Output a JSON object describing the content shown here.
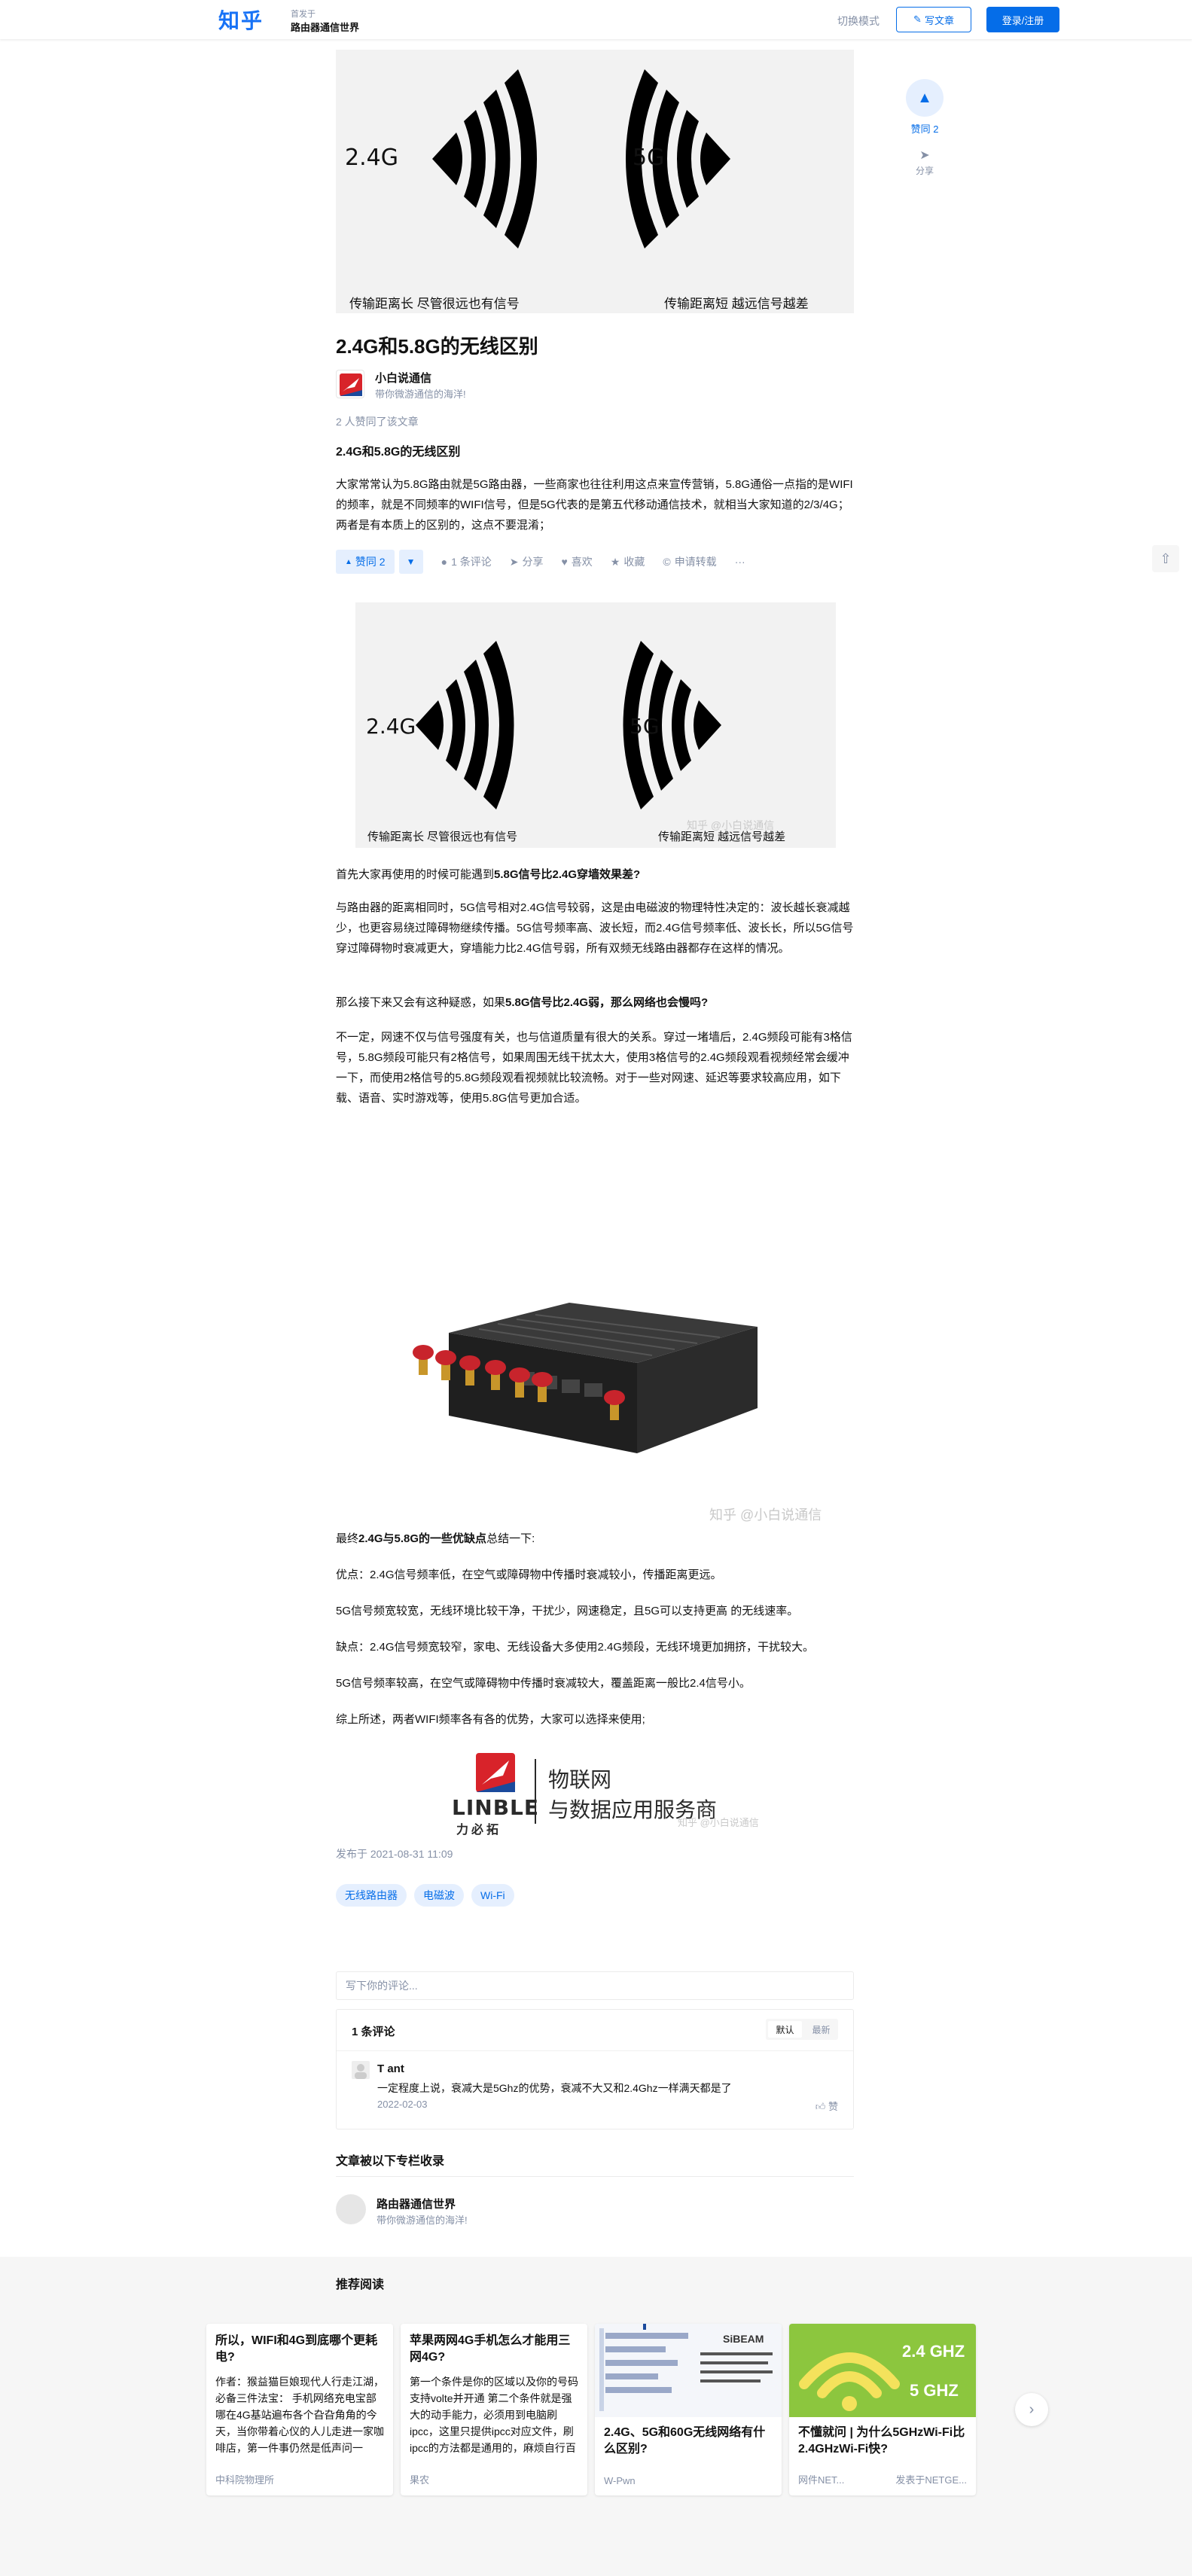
{
  "header": {
    "logo": "知乎",
    "column_sub": "首发于",
    "column_name": "路由器通信世界",
    "switch_mode": "切换模式",
    "write_label": "写文章",
    "login_label": "登录/注册"
  },
  "hero_image": {
    "left_band": "2.4G",
    "right_band": "5G",
    "left_caption": "传输距离长  尽管很远也有信号",
    "right_caption": "传输距离短  越远信号越差"
  },
  "side": {
    "vote_label": "赞同 2",
    "share_label": "分享"
  },
  "article": {
    "title": "2.4G和5.8G的无线区别",
    "author_name": "小白说通信",
    "author_bio": "带你微游通信的海洋!",
    "upvote_count": "2 人赞同了该文章",
    "subhead": "2.4G和5.8G的无线区别",
    "intro": "大家常常认为5.8G路由就是5G路由器，一些商家也往往利用这点来宣传营销，5.8G通俗一点指的是WIFI的频率，就是不同频率的WIFI信号，但是5G代表的是第五代移动通信技术，就相当大家知道的2/3/4G；两者是有本质上的区别的，这点不要混淆；",
    "q1_plain": "首先大家再使用的时候可能遇到",
    "q1_bold": "5.8G信号比2.4G穿墙效果差?",
    "p2": "与路由器的距离相同时，5G信号相对2.4G信号较弱，这是由电磁波的物理特性决定的：波长越长衰减越少，也更容易绕过障碍物继续传播。5G信号频率高、波长短，而2.4G信号频率低、波长长，所以5G信号穿过障碍物时衰减更大，穿墙能力比2.4G信号弱，所有双频无线路由器都存在这样的情况。",
    "q2_plain": "那么接下来又会有这种疑惑，如果",
    "q2_bold": "5.8G信号比2.4G弱，那么网络也会慢吗?",
    "p3": "不一定，网速不仅与信号强度有关，也与信道质量有很大的关系。穿过一堵墙后，2.4G频段可能有3格信号，5.8G频段可能只有2格信号，如果周围无线干扰太大，使用3格信号的2.4G频段观看视频经常会缓冲一下，而使用2格信号的5.8G频段观看视频就比较流畅。对于一些对网速、延迟等要求较高应用，如下载、语音、实时游戏等，使用5.8G信号更加合适。",
    "summary_pre": "最终",
    "summary_bold": "2.4G与5.8G的一些优缺点",
    "summary_post": "总结一下:",
    "pros1": "优点：2.4G信号频率低，在空气或障碍物中传播时衰减较小，传播距离更远。",
    "pros2": "5G信号频宽较宽，无线环境比较干净，干扰少，网速稳定，且5G可以支持更高 的无线速率。",
    "cons1": "缺点：2.4G信号频宽较窄，家电、无线设备大多使用2.4G频段，无线环境更加拥挤，干扰较大。",
    "cons2": "5G信号频率较高，在空气或障碍物中传播时衰减较大，覆盖距离一般比2.4信号小。",
    "conclusion": "综上所述，两者WIFI频率各有各的优势，大家可以选择来使用;",
    "watermark": "知乎 @小白说通信",
    "pubtime": "发布于 2021-08-31 11:09"
  },
  "actions": {
    "vote": "赞同 2",
    "comments": "1 条评论",
    "share": "分享",
    "like": "喜欢",
    "collect": "收藏",
    "reprint": "申请转载",
    "more": "···"
  },
  "logo_block": {
    "brand": "LINBLE",
    "brand_cn": "力必拓",
    "tag1": "物联网",
    "tag2": "与数据应用服务商"
  },
  "tags": [
    "无线路由器",
    "电磁波",
    "Wi-Fi"
  ],
  "comments": {
    "placeholder": "写下你的评论...",
    "count_label": "1 条评论",
    "sort_default": "默认",
    "sort_latest": "最新",
    "items": [
      {
        "user": "T ant",
        "text": "一定程度上说，衰减大是5Ghz的优势，衰减不大又和2.4Ghz一样满天都是了",
        "date": "2022-02-03",
        "like": "赞"
      }
    ]
  },
  "included": {
    "heading": "文章被以下专栏收录",
    "name": "路由器通信世界",
    "bio": "带你微游通信的海洋!"
  },
  "recommend": {
    "heading": "推荐阅读",
    "cards": [
      {
        "title": "所以，WIFI和4G到底哪个更耗电?",
        "excerpt": "作者：猴益猫巨娘现代人行走江湖，必备三件法宝： 手机网络充电宝部哪在4G基站遍布各个旮旮角角的今天，当你带着心仪的人儿走进一家咖啡店，第一件事仍然是低声问一句：\"WiFi?\" 这句话既...",
        "author": "中科院物理所"
      },
      {
        "title": "苹果两网4G手机怎么才能用三网4G?",
        "excerpt": "第一个条件是你的区域以及你的号码支持volte并开通 第二个条件就是强大的动手能力，必须用到电脑刷ipcc，这里只提供ipcc对应文件，刷ipcc的方法都是通用的，麻烦自行百度。 总结一下 先开通...",
        "author": "果农"
      },
      {
        "title": "2.4G、5G和60G无线网络有什么区别?",
        "author": "W-Pwn",
        "img_brand": "SiBEAM"
      },
      {
        "title": "不懂就问 | 为什么5GHzWi-Fi比2.4GHzWi-Fi快?",
        "author": "网件NET...",
        "author_right": "发表于NETGE...",
        "img_text1": "2.4 GHZ",
        "img_text2": "5 GHZ"
      }
    ]
  }
}
